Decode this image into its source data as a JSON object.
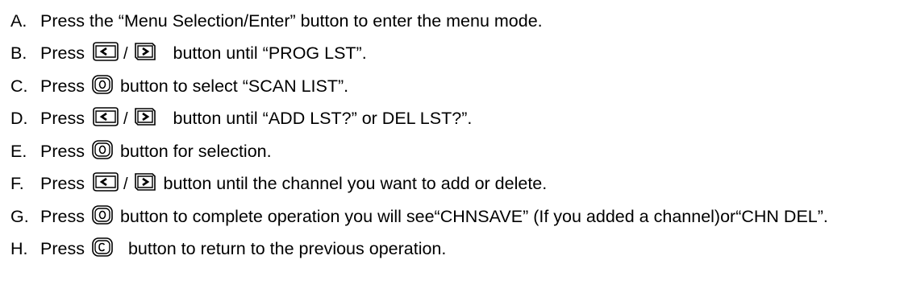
{
  "steps": [
    {
      "letter": "A.",
      "text": "Press the “Menu Selection/Enter” button to enter the menu mode."
    },
    {
      "letter": "B.",
      "pre": "Press",
      "post": "button until “PROG LST”.",
      "icons": [
        "left-arrow-key-icon",
        "right-arrow-key-icon"
      ]
    },
    {
      "letter": "C.",
      "pre": "Press",
      "post": "button to select “SCAN LIST”.",
      "icons": [
        "menu-enter-key-icon"
      ]
    },
    {
      "letter": "D.",
      "pre": "Press",
      "post": "button until “ADD LST?” or DEL LST?”.",
      "icons": [
        "left-arrow-key-icon",
        "right-arrow-key-icon"
      ]
    },
    {
      "letter": "E.",
      "pre": "Press",
      "post": "button for selection.",
      "icons": [
        "menu-enter-key-icon"
      ]
    },
    {
      "letter": "F.",
      "pre": "Press",
      "post": "button until the channel you want to add or delete.",
      "icons": [
        "left-arrow-key-icon",
        "right-arrow-key-icon"
      ]
    },
    {
      "letter": "G.",
      "pre": "Press",
      "post": "button to complete operation you will see“CHNSAVE” (If you added a channel)or“CHN DEL”.",
      "icons": [
        "menu-enter-key-icon"
      ]
    },
    {
      "letter": "H.",
      "pre": "Press",
      "post": "button to return to the previous operation.",
      "icons": [
        "clear-key-icon"
      ]
    }
  ],
  "separator": "/"
}
